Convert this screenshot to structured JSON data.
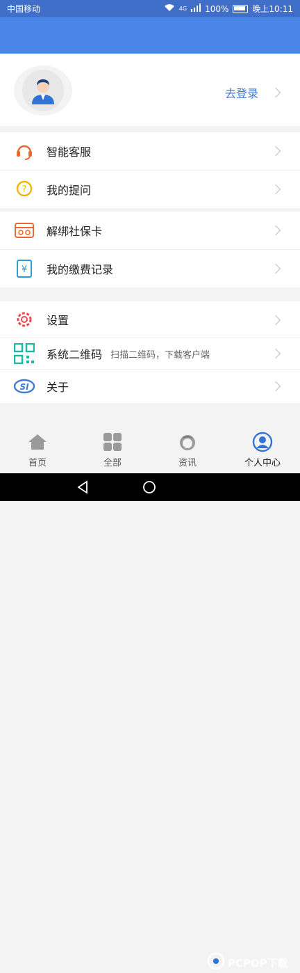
{
  "status_bar": {
    "carrier": "中国移动",
    "network": "4G",
    "battery": "100%",
    "time": "晚上10:11"
  },
  "profile": {
    "login_label": "去登录"
  },
  "menu": {
    "groups": [
      {
        "items": [
          {
            "label": "智能客服",
            "icon": "headset-icon"
          },
          {
            "label": "我的提问",
            "icon": "question-bubble-icon"
          }
        ]
      },
      {
        "items": [
          {
            "label": "解绑社保卡",
            "icon": "card-icon"
          },
          {
            "label": "我的缴费记录",
            "icon": "payment-record-icon"
          }
        ]
      },
      {
        "items": [
          {
            "label": "设置",
            "icon": "gear-icon"
          },
          {
            "label": "系统二维码",
            "sub": "扫描二维码，下载客户端",
            "icon": "qrcode-icon"
          },
          {
            "label": "关于",
            "icon": "si-logo-icon"
          }
        ]
      }
    ]
  },
  "tabbar": {
    "tabs": [
      {
        "label": "首页",
        "icon": "home-icon"
      },
      {
        "label": "全部",
        "icon": "grid-icon"
      },
      {
        "label": "资讯",
        "icon": "news-icon"
      },
      {
        "label": "个人中心",
        "icon": "user-circle-icon",
        "active": true
      }
    ]
  },
  "watermark": {
    "text": "PCPOP下载"
  },
  "colors": {
    "accent": "#4a86e8",
    "link": "#3f7ad8",
    "status_bar": "#3f6fc9"
  }
}
